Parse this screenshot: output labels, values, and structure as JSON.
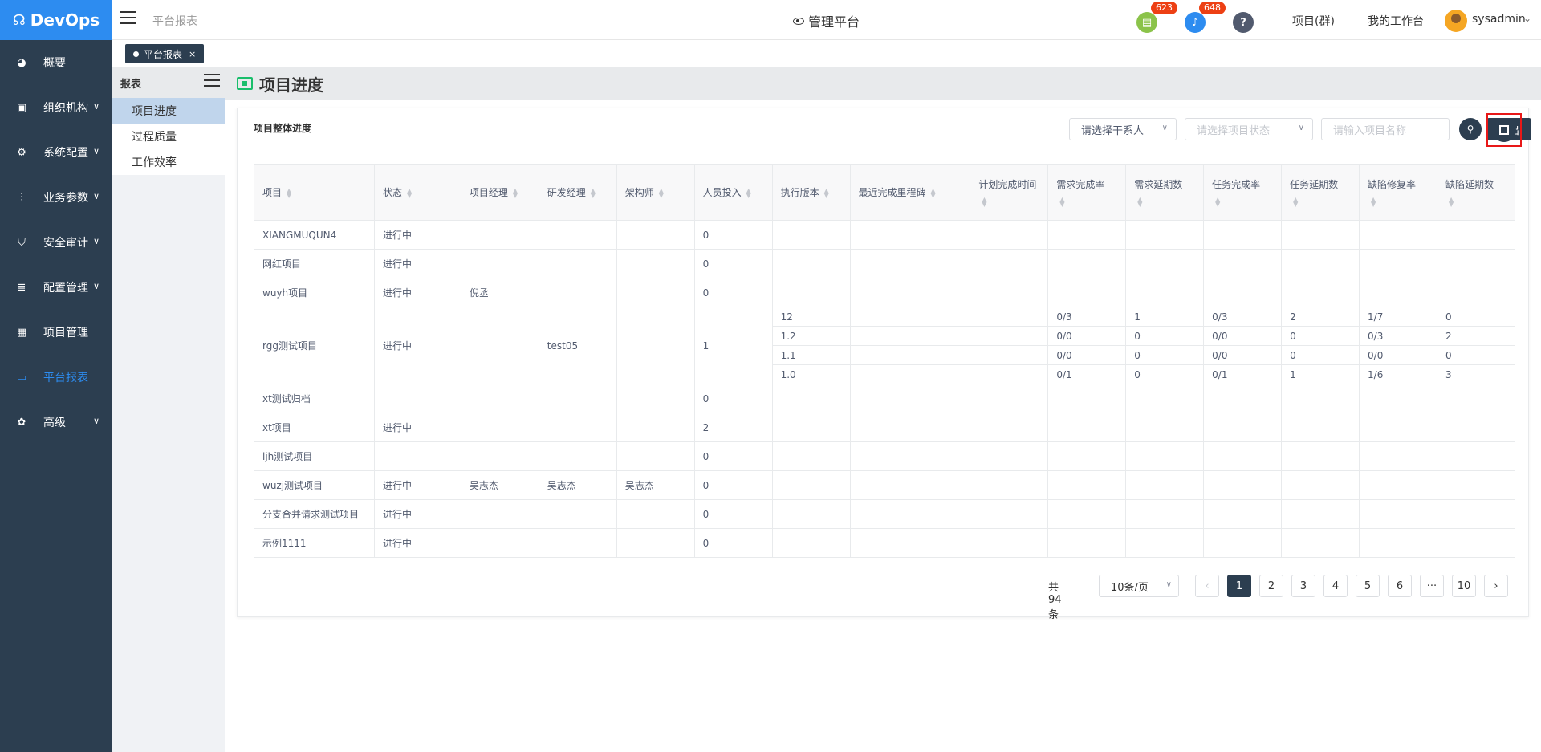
{
  "app": {
    "logo": "DevOps",
    "breadcrumb": "平台报表",
    "platform_title": "管理平台"
  },
  "header": {
    "badge_doc": "623",
    "badge_bell": "648",
    "help": "?",
    "project_group": "项目(群)",
    "workspace": "我的工作台",
    "user": "sysadmin"
  },
  "sidebar": {
    "items": [
      {
        "label": "概要",
        "icon": "dashboard-icon"
      },
      {
        "label": "组织机构",
        "icon": "lock-icon"
      },
      {
        "label": "系统配置",
        "icon": "gear-icon"
      },
      {
        "label": "业务参数",
        "icon": "sliders-icon"
      },
      {
        "label": "安全审计",
        "icon": "shield-icon"
      },
      {
        "label": "配置管理",
        "icon": "database-icon"
      },
      {
        "label": "项目管理",
        "icon": "grid-icon"
      },
      {
        "label": "平台报表",
        "icon": "monitor-icon"
      },
      {
        "label": "高级",
        "icon": "palette-icon"
      }
    ]
  },
  "tabs": {
    "active": "平台报表",
    "close": "×"
  },
  "submenu": {
    "header": "报表",
    "items": [
      "项目进度",
      "过程质量",
      "工作效率"
    ]
  },
  "page": {
    "title": "项目进度"
  },
  "card": {
    "title": "项目整体进度",
    "filter_stakeholder": "请选择干系人",
    "filter_status": "请选择项目状态",
    "search_placeholder": "请输入项目名称",
    "export": "导出"
  },
  "table": {
    "columns": [
      "项目",
      "状态",
      "项目经理",
      "研发经理",
      "架构师",
      "人员投入",
      "执行版本",
      "最近完成里程碑",
      "计划完成时间",
      "需求完成率",
      "需求延期数",
      "任务完成率",
      "任务延期数",
      "缺陷修复率",
      "缺陷延期数"
    ],
    "rows": [
      {
        "name": "XIANGMUQUN4",
        "status": "进行中",
        "pm": "",
        "dm": "",
        "arch": "",
        "staff": "0"
      },
      {
        "name": "网红项目",
        "status": "进行中",
        "pm": "",
        "dm": "",
        "arch": "",
        "staff": "0"
      },
      {
        "name": "wuyh项目",
        "status": "进行中",
        "pm": "倪丞",
        "dm": "",
        "arch": "",
        "staff": "0"
      },
      {
        "name": "rgg测试项目",
        "status": "进行中",
        "pm": "",
        "dm": "test05",
        "arch": "",
        "staff": "1",
        "versions": [
          {
            "ver": "12",
            "req_rate": "0/3",
            "req_delay": "1",
            "task_rate": "0/3",
            "task_delay": "2",
            "bug_rate": "1/7",
            "bug_delay": "0"
          },
          {
            "ver": "1.2",
            "req_rate": "0/0",
            "req_delay": "0",
            "task_rate": "0/0",
            "task_delay": "0",
            "bug_rate": "0/3",
            "bug_delay": "2"
          },
          {
            "ver": "1.1",
            "req_rate": "0/0",
            "req_delay": "0",
            "task_rate": "0/0",
            "task_delay": "0",
            "bug_rate": "0/0",
            "bug_delay": "0"
          },
          {
            "ver": "1.0",
            "req_rate": "0/1",
            "req_delay": "0",
            "task_rate": "0/1",
            "task_delay": "1",
            "bug_rate": "1/6",
            "bug_delay": "3"
          }
        ]
      },
      {
        "name": "xt测试归档",
        "status": "",
        "pm": "",
        "dm": "",
        "arch": "",
        "staff": "0"
      },
      {
        "name": "xt项目",
        "status": "进行中",
        "pm": "",
        "dm": "",
        "arch": "",
        "staff": "2"
      },
      {
        "name": "ljh测试项目",
        "status": "",
        "pm": "",
        "dm": "",
        "arch": "",
        "staff": "0"
      },
      {
        "name": "wuzj测试项目",
        "status": "进行中",
        "pm": "吴志杰",
        "dm": "吴志杰",
        "arch": "吴志杰",
        "staff": "0"
      },
      {
        "name": "分支合并请求测试项目",
        "status": "进行中",
        "pm": "",
        "dm": "",
        "arch": "",
        "staff": "0"
      },
      {
        "name": "示例1111",
        "status": "进行中",
        "pm": "",
        "dm": "",
        "arch": "",
        "staff": "0"
      }
    ]
  },
  "pagination": {
    "total": "共 94 条",
    "page_size": "10条/页",
    "pages": [
      "1",
      "2",
      "3",
      "4",
      "5",
      "6",
      "···",
      "10"
    ],
    "prev": "‹",
    "next": "›"
  },
  "colors": {
    "primary": "#2d8cf0",
    "sidebar": "#2c3e50",
    "highlight": "#e81818"
  }
}
